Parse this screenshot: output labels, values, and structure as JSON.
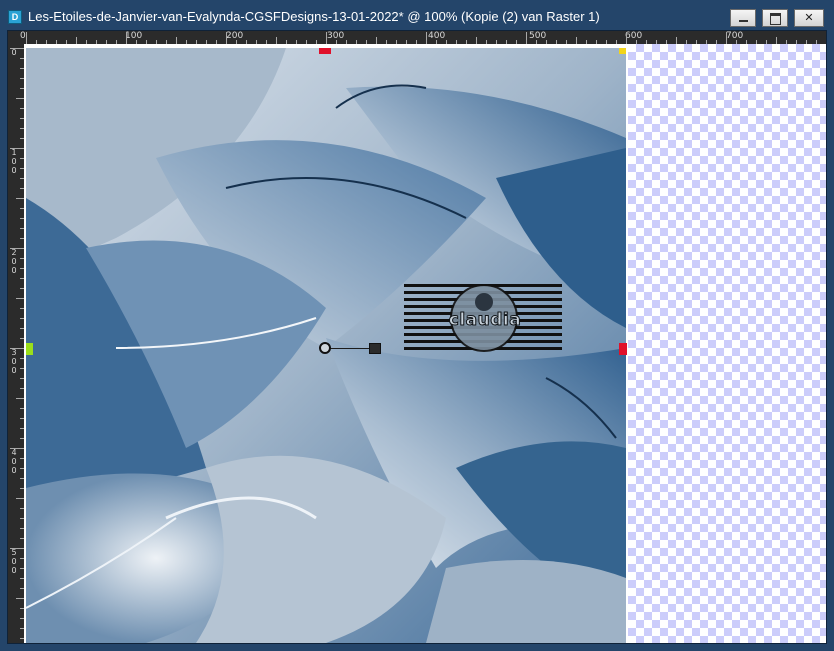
{
  "window": {
    "title": "Les-Etoiles-de-Janvier-van-Evalynda-CGSFDesigns-13-01-2022* @ 100% (Kopie (2) van Raster 1)",
    "app_icon_glyph": "D"
  },
  "ruler_top": {
    "labels": [
      "0",
      "100",
      "200",
      "300",
      "400",
      "500",
      "600",
      "700"
    ]
  },
  "ruler_left": {
    "labels": [
      "0",
      "1 0 0",
      "2 0 0",
      "3 0 0",
      "4 0 0",
      "5 0 0"
    ]
  },
  "canvas": {
    "watermark_text": "claudia"
  },
  "colors": {
    "title_bar": "#24456a",
    "ruler": "#2b2b2b",
    "checker": "#cccdfb",
    "marker_red": "#e0102a",
    "marker_green": "#9adf1a",
    "marker_yellow": "#f2d41a"
  }
}
